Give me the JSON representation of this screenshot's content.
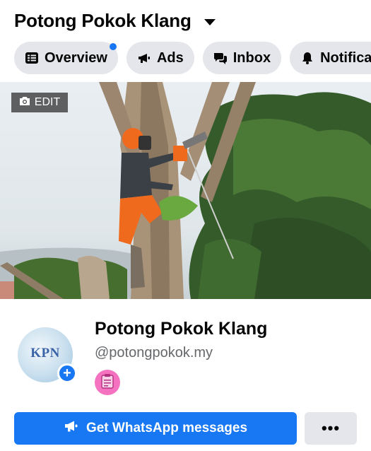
{
  "header": {
    "title": "Potong Pokok Klang"
  },
  "tabs": [
    {
      "label": "Overview",
      "icon": "list-icon",
      "has_notification_dot": true
    },
    {
      "label": "Ads",
      "icon": "megaphone-icon"
    },
    {
      "label": "Inbox",
      "icon": "chat-bubbles-icon"
    },
    {
      "label": "Notificat",
      "icon": "bell-icon"
    }
  ],
  "cover": {
    "edit_label": "EDIT",
    "edit_icon": "camera-icon"
  },
  "profile": {
    "avatar_text": "KPN",
    "name": "Potong Pokok Klang",
    "handle": "@potongpokok.my",
    "badge_icon": "clipboard-icon"
  },
  "actions": {
    "primary_label": "Get WhatsApp messages",
    "primary_icon": "megaphone-icon",
    "more_label": "•••"
  },
  "colors": {
    "accent": "#1877f2",
    "tab_bg": "#e4e6eb",
    "badge": "#f472c0"
  }
}
